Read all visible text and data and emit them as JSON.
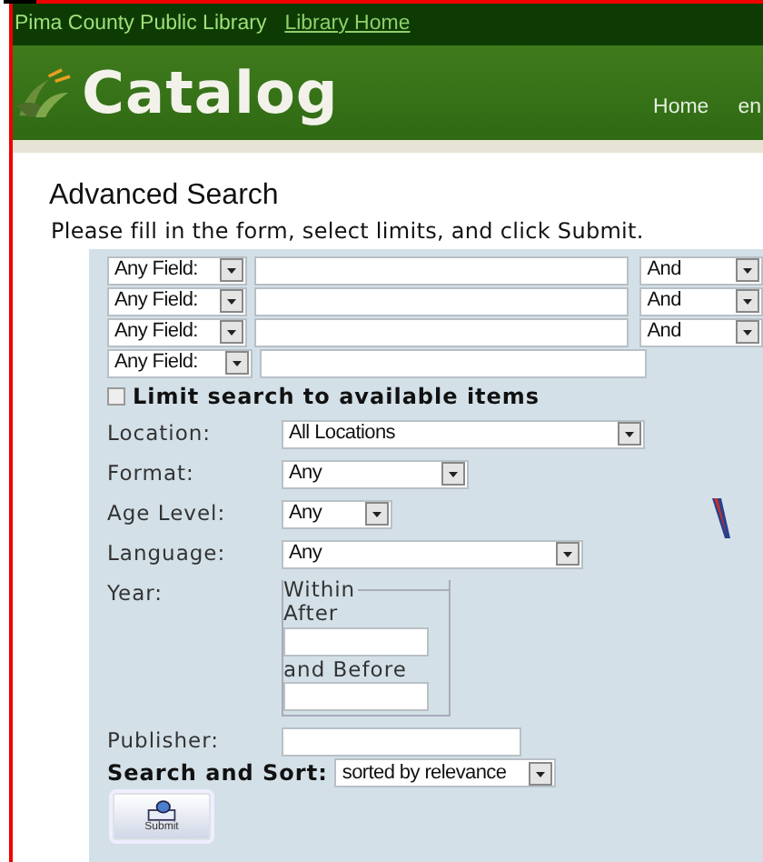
{
  "header": {
    "library_name": "Pima County Public Library",
    "home_link": "Library Home",
    "logo_text": "Catalog",
    "nav": [
      "Home",
      "en"
    ]
  },
  "page_title": "Advanced Search",
  "instructions": "Please fill in the form, select limits, and click Submit.",
  "search_rows": [
    {
      "field": "Any Field:",
      "operator": "And"
    },
    {
      "field": "Any Field:",
      "operator": "And"
    },
    {
      "field": "Any Field:",
      "operator": "And"
    },
    {
      "field": "Any Field:"
    }
  ],
  "limit_available": {
    "label": "Limit search to available items",
    "checked": false
  },
  "limits": [
    {
      "kind": "select",
      "label": "Location:",
      "value": "All Locations"
    },
    {
      "kind": "select",
      "label": "Format:",
      "value": "Any"
    },
    {
      "kind": "select",
      "label": "Age Level:",
      "value": "Any"
    },
    {
      "kind": "select",
      "label": "Language:",
      "value": "Any"
    },
    {
      "kind": "range",
      "label": "Year:",
      "legend": "Within",
      "after_label": "After",
      "before_label": "and Before"
    },
    {
      "kind": "text",
      "label": "Publisher:"
    }
  ],
  "sort": {
    "label": "Search and Sort:",
    "value": "sorted by relevance"
  },
  "submit": {
    "label": "Submit"
  }
}
